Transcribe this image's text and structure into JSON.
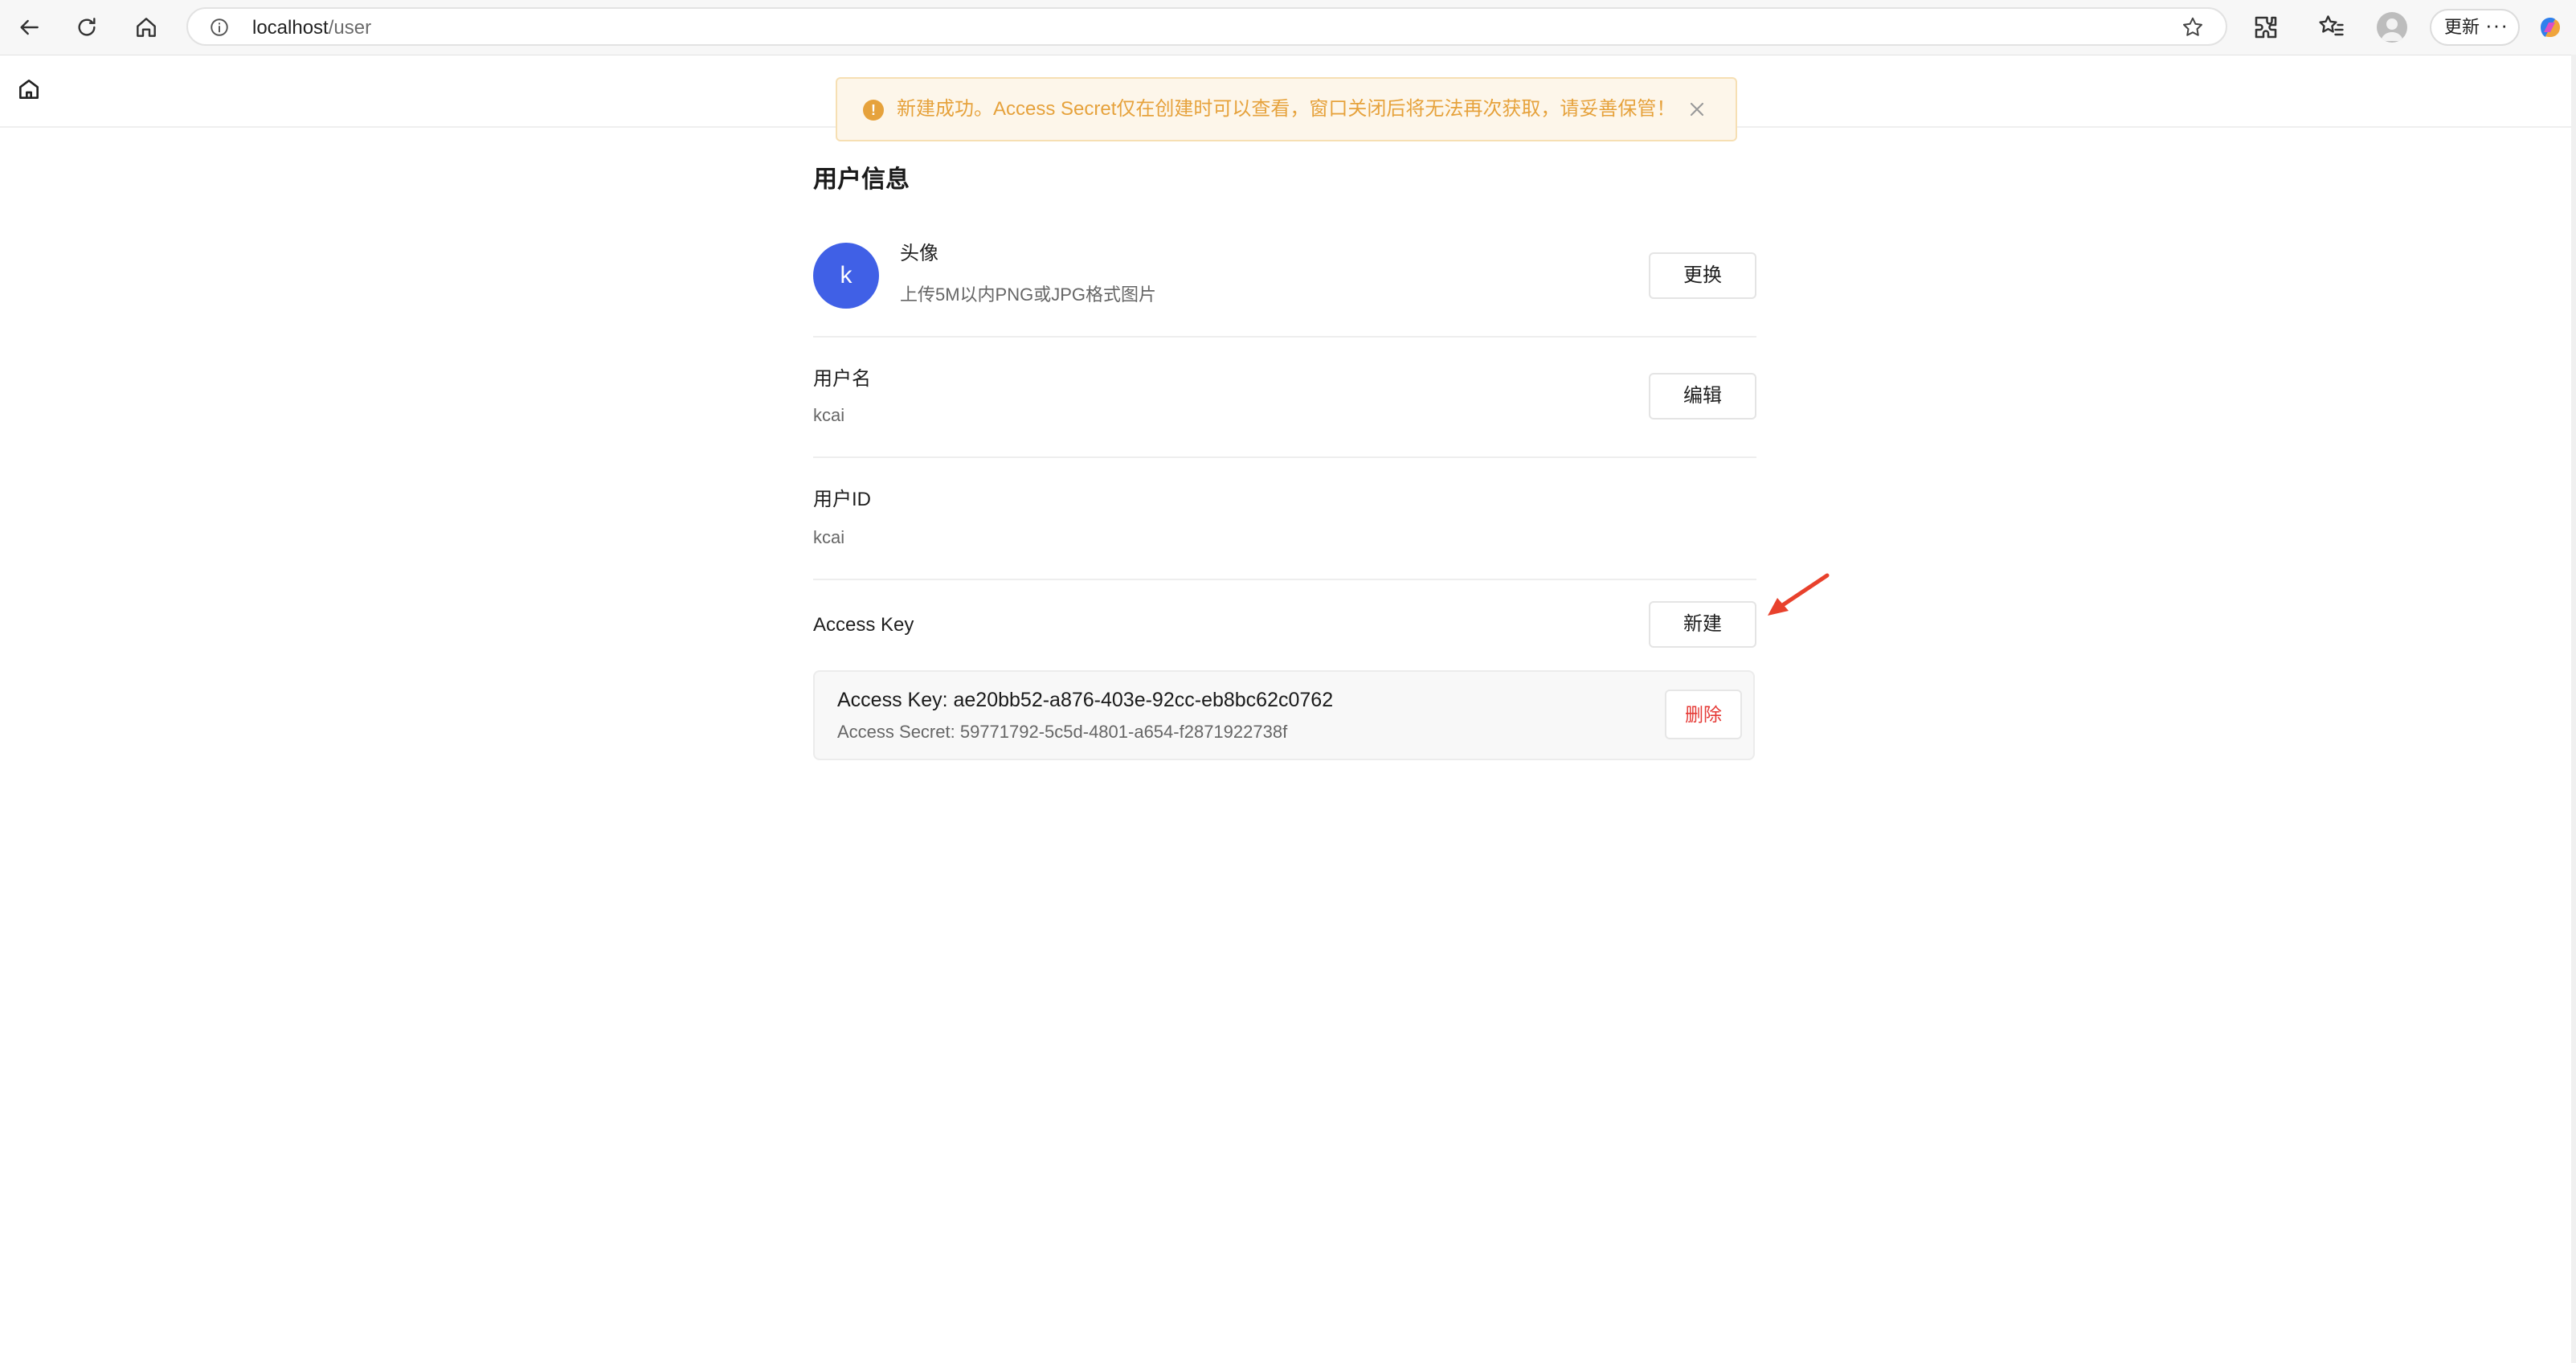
{
  "browser": {
    "url_host": "localhost",
    "url_path": "/user",
    "update_label": "更新",
    "more_label": "···"
  },
  "toast": {
    "message": "新建成功。Access Secret仅在创建时可以查看，窗口关闭后将无法再次获取，请妥善保管！",
    "icon": "!"
  },
  "page": {
    "title": "用户信息"
  },
  "avatar_row": {
    "initial": "k",
    "label": "头像",
    "hint": "上传5M以内PNG或JPG格式图片",
    "button": "更换"
  },
  "username_row": {
    "label": "用户名",
    "value": "kcai",
    "button": "编辑"
  },
  "userid_row": {
    "label": "用户ID",
    "value": "kcai"
  },
  "access_key_row": {
    "label": "Access Key",
    "button": "新建"
  },
  "key_card": {
    "key_line": "Access Key: ae20bb52-a876-403e-92cc-eb8bc62c0762",
    "secret_line": "Access Secret: 59771792-5c5d-4801-a654-f2871922738f",
    "delete_button": "删除"
  },
  "colors": {
    "accent": "#4060e6",
    "warning": "#e6a23c",
    "danger": "#e53935",
    "annotation_arrow": "#e8412c"
  }
}
